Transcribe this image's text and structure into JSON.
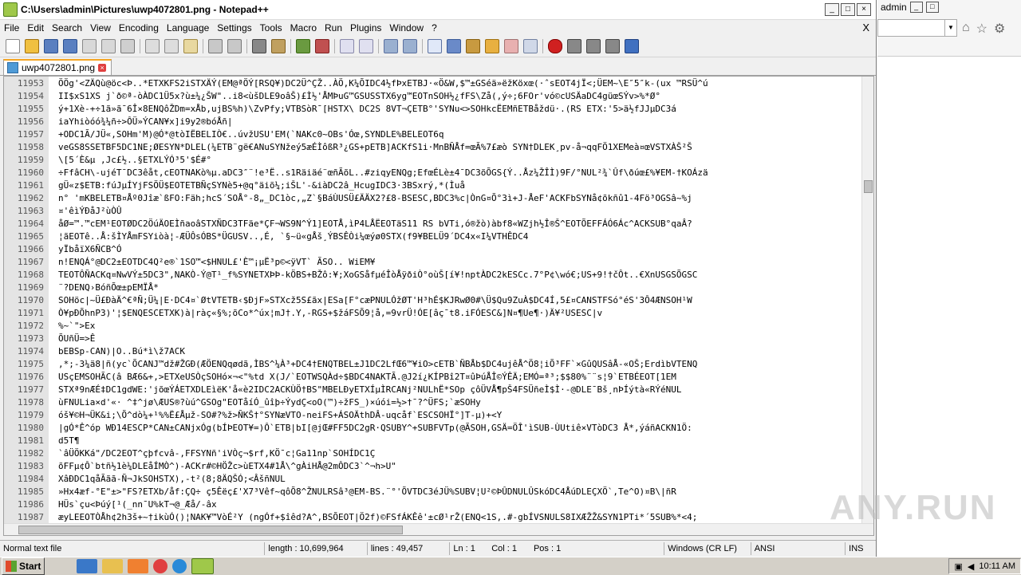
{
  "window": {
    "title": "C:\\Users\\admin\\Pictures\\uwp4072801.png - Notepad++"
  },
  "menu": [
    "File",
    "Edit",
    "Search",
    "View",
    "Encoding",
    "Language",
    "Settings",
    "Tools",
    "Macro",
    "Run",
    "Plugins",
    "Window",
    "?"
  ],
  "menu_close": "X",
  "tab": {
    "label": "uwp4072801.png"
  },
  "editor": {
    "lines": [
      {
        "n": "11953",
        "t": "ÖÖg'<ZÄQù@öc<Þ..*ETXKFS2iSTXÄÝ(EM@ªÖÝ[RSQ¥)DC2Ü^ÇŽ..ÀÖ,K¼ÕIDC4½fÞxETBJ·«Ö&W,$™±GSéä»ëžKöxœ(·ˆsEOT4jÏ<;ÜEM~\\E″5″k-(ux ™RSÜ^ú"
      },
      {
        "n": "11954",
        "t": "II$xS1XS   j`ð©ª-òÀDC1Ü5x?ù±¼¿ŠW\"..i8<ùšDLE9oâŠ)£Ì½'ÅMÞuG™GSUSSTX6yg™EOTnSOH½¿fFS\\Zå(,ý÷;6FOr'vó©cUSÄaDC4güœSÝv>%*Ø°"
      },
      {
        "n": "11955",
        "t": "ý+1Xè-+÷1ã»ã¯6Î×8ENQôŽDm=xÅb,ujBS%h)\\ZvPfy;VTBSòR¯[HSTX\\  DC2S    8VT¬ÇETB°'SYNu<>SOHkcËEMñETBåždü·.(RS ETX:'5>ä½fJJµDC3á"
      },
      {
        "n": "11956",
        "t": "iaYhiòóó¾¼ñ÷>ÔÜ»ÝCAN¥x]i9y2®bóÅñ|"
      },
      {
        "n": "11957",
        "t": "+ODC1Ã/JÜ«,SOHm'M)@Ó*@tòIËBELIÒ€..úvžUSU'EM(`NAKc0~OBs'Óœ,SYNDLE%BELEOT6q"
      },
      {
        "n": "11958",
        "t": "veGS8SSETBF5DC1NE;ØESYN*DLEL(¼ETB¨gë€ANuSYNžeý5æÉÌôßR³¿GS+pETB]ACKfS1i·MnBÑÅf=œÃ%7£æò SYN†DLEK¸pv-å¬qqFÖ1XEMeà¤œVSTXÀŠ²Š"
      },
      {
        "n": "11959",
        "t": "\\[5´È&µ ,Jc£½..§ETXLÝÓ³5'$É#°"
      },
      {
        "n": "11960",
        "t": "÷FfâCH\\-ujéT¯DC3êåt,cEOTNAKò%µ.aDC3″¨!e³Ë..s1Räiäé¨œñÃõL..#ziqyENQg;EfœÉLè±4¯DC3õÕGS{Ý..Åz¼ŽÎÌ)9F/°NUL²¾`Ûf\\ðúœ£%¥EM-†KOÁzä"
      },
      {
        "n": "11961",
        "t": "gÜ«z$ETB:fúJµÍYjFSÖÜ$EOTETBÑçSYNè5+@q°äiõ¼;iŠL'-&iàDC2â_HcugIDC3·3BSxrý,*(Ìuå"
      },
      {
        "n": "11962",
        "t": "n°  'mKBELETB¤Åº0Jîæ`ßFO:Fäh;hcS´SOÅ°-8„_DC1òc,„Z`§BáÙUSÜ£ÄÄX2?£8-BSESC,BDC3%c|ÒnG¤Õ°3ì+J-ÅeF'ACKFbSYNå¢õkñû1-4Fö³OGSâ~%j"
      },
      {
        "n": "11963",
        "t": "¤'êìÝÐåJ²ùÒÛ"
      },
      {
        "n": "11964",
        "t": "åØ=™.™cEM¹EOTØDC2ÖúÄOEÌñaoâSTXÑDC3TFäe*ÇF¬WS9N^Ý1]EOTÅ,ìP4LÅËEOTäS11 RS bVTi,ó®žò)àbf8«WZjh½Î®Š^EOTÕEFFÁÓ6Ác^ACKSUB°qaÂ?"
      },
      {
        "n": "11965",
        "t": "¦ãEOTê..Å:šÌYÅmFSYiòà¦-ÆÜÔsÓBS*ÜGUSV..,É, `§~ü«gÅš¸ÝBSÊÒi¼œýø0STX(f9¥BELÜ9´DC4x«I¼VTHÊDC4"
      },
      {
        "n": "11966",
        "t": "yÏbåïX6ÑCB^Ó"
      },
      {
        "n": "11967",
        "t": "n!ENQÁ°@DC2±EOTDC4Q²e®`1SO™<$HNUL£'È™¡µË³p©<ÿVT`  ÃSO..    WiEM¥"
      },
      {
        "n": "11968",
        "t": "TEOTÔÑACKq¤NwVÝ±5DC3\",NAKÒ-Ý@T¹_f%SYNETXÞÞ-kÖBS+BŽô:¥;XoGSåfµéÎòÅÿðiÒ°oùŠ[í¥!nptÀDC2kESCc.7°P¢\\wó€;US+9!†čÔt..€XnUSGSÕGSC"
      },
      {
        "n": "11969",
        "t": "  ¨?DENQ›BóñÕœ±pEMÏÅ*"
      },
      {
        "n": "11970",
        "t": "SOHöc|~Ü£ÐàÄ^€ªÑ;Ü¼|E·DC4¤`ØtVTETB‹$ÐjF»STXcž5S£ãx|ESa[F°cæPNULÓžØT'H³hÉ$KJRwØ0#\\Ü$Qu9ZuÀ$DC4Í,5£¤CANSTFSó°éS'3Ô4ÆNSOH¹W"
      },
      {
        "n": "11971",
        "t": "Ò¥pÐÕhnP3)'¦$ENQESCETXK)à|ràç«§%;õCo*^úx¦mJ†.Y,-RGS+$žáFSÕ9¦å,=9vrÜ!ÓE[âç¯t8.iFÓESC&]N¤¶Ue¶·)Ä¥²USESC|v"
      },
      {
        "n": "11972",
        "t": "%~`\">Ex"
      },
      {
        "n": "11973",
        "t": "ÕUñÜ=>Ê"
      },
      {
        "n": "11974",
        "t": "bEBSp-CAN)|O..Bú*ì\\ž7ACK"
      },
      {
        "n": "11975",
        "t": ",*;-3¼ä8|ñ(yc`ÕCANJ™dž#ŽGÐ(ÆÖENQqødã,ÌBS^¼À³+DC4†ENQTBEL±J1DC2LfŒ6™¥iO>cETB`ÑBÅb$DC4ujêÅ^Ö8¦iÕ³FF`×GûQUSâÅ-«OŠ;ErdìbVTENQ"
      },
      {
        "n": "11976",
        "t": "USçEMSOHÃC(â   BÆ6&+,>ETXeUSÒçSOHó×¬<\"%td X(J/`EOTWSQÀd÷$BDC4NAKTÃ.@J2í¿KÍPBî2T¤ûÞúÅÎ©ÝÊÄ;EMÓ=ª³;$$80%¨¨s¦9`ETBÉEOT[1EM"
      },
      {
        "n": "11977",
        "t": "STXª9nÆÉ‡DC1gdWE:'jõœÝÁETXDLEìëK'å«è2IDC2ACKÙÖ†BS\"MBELÐyETXÍµÌRCANj²NULhË*SOp   çôÜVÅ¶pŠ4FSÜñeÌ$Ì·-@DLE¯Bš¸nÞÍýtà«RÝéNUL"
      },
      {
        "n": "11978",
        "t": "ùFNULia×d'«· ^‡^jø\\ÆUS®?ùú^GSOg\"EOTåíÓ_ûîþ÷ÝydÇ<oO(™)÷žFS_)×úói=½>†¯?^ÜFS;`æSOHy"
      },
      {
        "n": "11979",
        "t": "óš¥©H¬ÜK&i;\\Õ^dò¼+¹%%Ë£Åµž-SO#?%ž>ÑKŠ†°SYNæVTO-neiFS+ÁSOÄthDÂ-uqcåf`ESCSOHÏ°]T-µ)+<Y"
      },
      {
        "n": "11980",
        "t": "|gÓ*Ê^óp WÐ14ESCP*CAN±CANjxÓg(bÍÞEOT¥=)Ô`ETB|bI[@jŒ#FF5DC2gR·QSUBY^+SUBFVTp(@ÃSOH,GSÄ=ÖÎ'ìSUB-ÙUtiê×VTòDC3 Å*,ýáñACKN1Ö:"
      },
      {
        "n": "11981",
        "t": "d5T¶"
      },
      {
        "n": "11982",
        "t": "`âÜÖKKá\"/DC2EOT^çþfcvâ-,FFSYNñ'iVÒç¬$rf,KÖ¯c¦Ga11np`SOHÍDC1Ç"
      },
      {
        "n": "11983",
        "t": "õFFµ¢Ô`btñ½1è¼DLEåÍMÒ^)-ACKr#©HÖŽc>ùETX4#1Å\\^gÀiHÅ@2mÔDC3`^¬h>U\""
      },
      {
        "n": "11984",
        "t": "XâÐDC1qåÃãã-Ñ¬JkSOHSTX),-t²(8;8ÄQŠÓ;<ÂšñNUL"
      },
      {
        "n": "11985",
        "t": "»Hx4æf-°E\"±>\"FS?ETXb/åf:ÇQ÷    ç5Êëç£'X7³Vêf~qôÕ8^ŽNULRSâ³@EM-BS.¨°'ÕVTDC3éJÜ%SUBV¦U²©ÞÛDNULÛSkóDC4ÅúDLEÇXÖ`,Te^O)¤B\\|ñR"
      },
      {
        "n": "11986",
        "t": "HÜs`çu<Þúý[¹(_nn¯U%kT¬@_Æå/-âx"
      },
      {
        "n": "11987",
        "t": "æyLEEOTÒÅh¢2h3š+~†ikùÓ()¦NAK¥™VòÉ²Y (ngÓf+$îêd?A^,BSÕEOT|Ö2f)©FSfÁKÊê'±cØ¹rŽ(ENQ<1S,.#-gbÍVSNULS8IXÆŽŽ&SYN1PTi*´5SUB%*<4;"
      }
    ]
  },
  "status": {
    "type": "Normal text file",
    "length": "length : 10,699,964",
    "lines": "lines : 49,457",
    "ln": "Ln : 1",
    "col": "Col : 1",
    "pos": "Pos : 1",
    "eol": "Windows (CR LF)",
    "encoding": "ANSI",
    "mode": "INS"
  },
  "browser": {
    "user_label": "admin"
  },
  "taskbar": {
    "start_label": "Start",
    "time": "10:11 AM"
  },
  "watermark": "ANY.RUN",
  "colors": {
    "tab_accent": "#f5a623",
    "gutter_bg": "#e4e4e4",
    "control_char_bg": "#000000"
  }
}
